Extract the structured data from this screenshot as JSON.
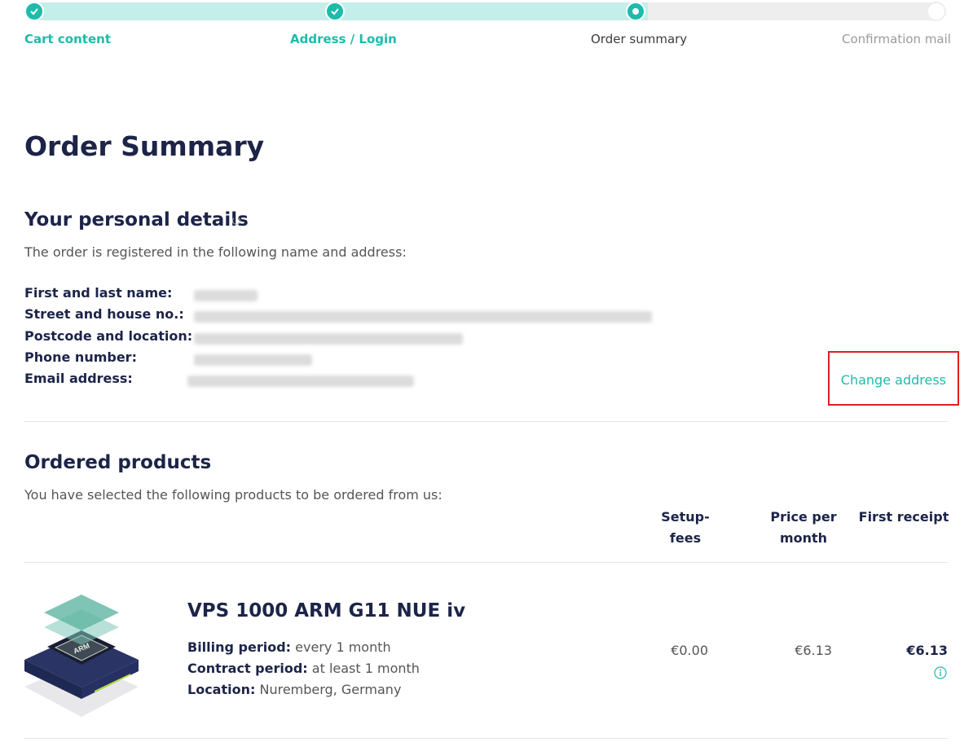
{
  "progress": {
    "fill_fraction": 0.68,
    "steps": [
      {
        "label": "Cart content",
        "state": "done"
      },
      {
        "label": "Address / Login",
        "state": "done"
      },
      {
        "label": "Order summary",
        "state": "current"
      },
      {
        "label": "Confirmation mail",
        "state": "todo"
      }
    ]
  },
  "page_title": "Order Summary",
  "personal": {
    "heading": "Your personal details",
    "intro": "The order is registered in the following name and address:",
    "fields": {
      "name_label": "First and last name:",
      "street_label": "Street and house no.:",
      "postcode_label": "Postcode and location:",
      "phone_label": "Phone number:",
      "email_label": "Email address:"
    },
    "change_address": "Change address"
  },
  "products": {
    "heading": "Ordered products",
    "intro": "You have selected the following products to be ordered from us:",
    "columns": {
      "setup_line1": "Setup-",
      "setup_line2": "fees",
      "price_line1": "Price per",
      "price_line2": "month",
      "first_receipt": "First receipt"
    },
    "items": [
      {
        "name": "VPS 1000 ARM G11 NUE iv",
        "billing_label": "Billing period:",
        "billing_value": " every 1 month",
        "contract_label": "Contract period:",
        "contract_value": " at least 1 month",
        "location_label": "Location:",
        "location_value": " Nuremberg, Germany",
        "setup_fee": "€0.00",
        "price_month": "€6.13",
        "first_receipt": "€6.13",
        "chip_text": "ARM"
      }
    ]
  },
  "colors": {
    "accent": "#1cbcaa",
    "accent_light": "#c4eeea",
    "navy": "#1c2448",
    "highlight": "#e0201d"
  }
}
